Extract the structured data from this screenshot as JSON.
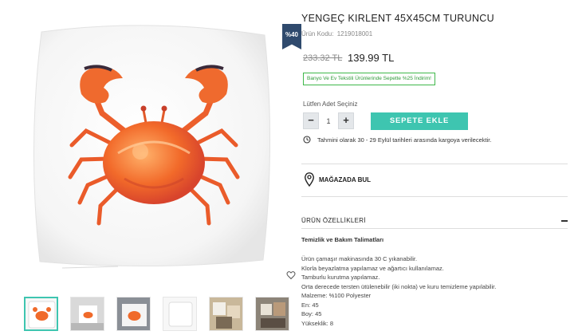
{
  "product": {
    "title": "YENGEÇ KIRLENT 45X45CM TURUNCU",
    "sku_label": "Ürün Kodu:",
    "sku": "1219018001",
    "old_price": "233.32 TL",
    "new_price": "139.99 TL",
    "discount_badge": "%40",
    "promo": "Banyo Ve Ev Tekstili Ürünlerinde Sepette %25 İndirim!"
  },
  "purchase": {
    "qty_label": "Lütfen Adet Seçiniz",
    "qty_minus": "−",
    "qty_value": "1",
    "qty_plus": "+",
    "add_to_cart": "SEPETE EKLE",
    "shipping_text": "Tahmini olarak 30 - 29 Eylül tarihleri arasında kargoya verilecektir."
  },
  "store": {
    "label": "MAĞAZADA BUL"
  },
  "specs": {
    "header": "ÜRÜN ÖZELLİKLERİ",
    "care_title": "Temizlik ve Bakım Talimatları",
    "lines": [
      "Ürün çamaşır makinasında 30 C yıkanabilir.",
      "Klorla beyazlatma yapılamaz ve ağartıcı kullanılamaz.",
      "Tamburlu kurutma yapılamaz.",
      "Orta derecede tersten ütülenebilir (iki nokta) ve kuru temizleme yapılabilir.",
      "Malzeme: %100 Polyester",
      "En: 45",
      "Boy: 45",
      "Yükseklik: 8"
    ]
  },
  "icons": {
    "favorite": "heart-outline-icon",
    "shipping": "clock-icon",
    "store": "map-pin-icon",
    "collapse": "minus-icon"
  },
  "colors": {
    "accent": "#3ec5b0",
    "badge": "#2f4a6d",
    "promo_green": "#3fb84a",
    "crab_orange": "#f06a2a"
  }
}
